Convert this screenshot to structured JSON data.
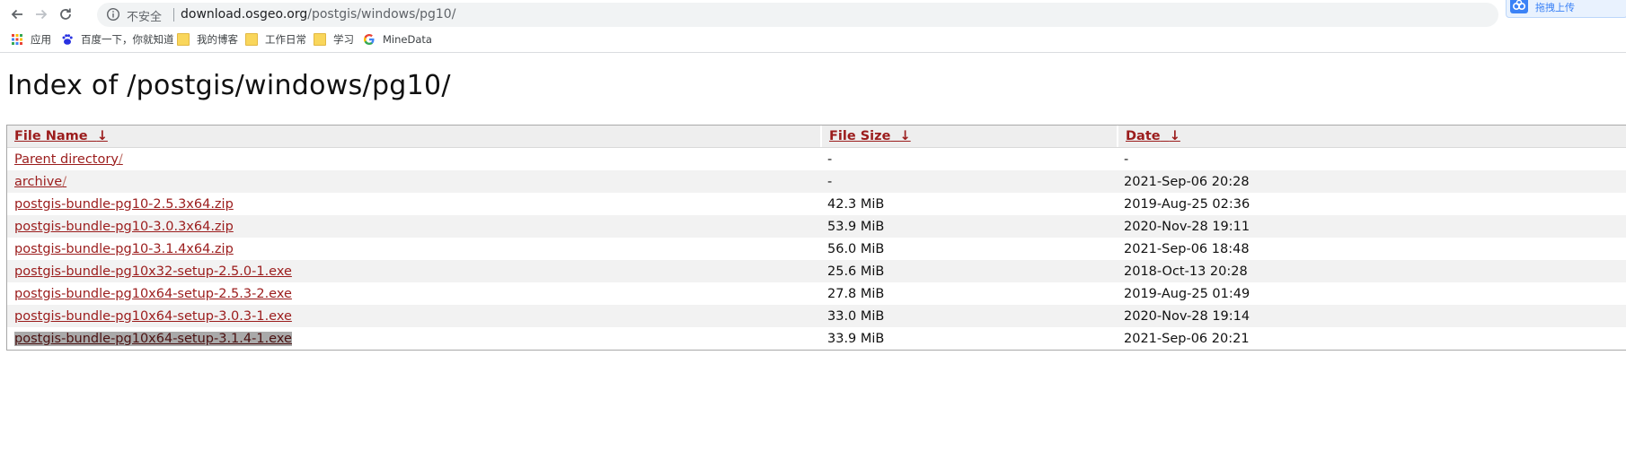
{
  "browser": {
    "omnibox": {
      "security_label": "不安全",
      "url_host": "download.osgeo.org",
      "url_path": "/postgis/windows/pg10/"
    },
    "extension_badge": {
      "label": "拖拽上传"
    }
  },
  "bookmarks": [
    {
      "label": "应用",
      "icon": "apps-grid-icon"
    },
    {
      "label": "百度一下，你就知道",
      "icon": "baidu-paw-icon"
    },
    {
      "label": "我的博客",
      "icon": "folder-icon"
    },
    {
      "label": "工作日常",
      "icon": "folder-icon"
    },
    {
      "label": "学习",
      "icon": "folder-icon"
    },
    {
      "label": "MineData",
      "icon": "google-g-icon"
    }
  ],
  "page": {
    "title": "Index of /postgis/windows/pg10/"
  },
  "table": {
    "headers": {
      "name": "File Name",
      "size": "File Size",
      "date": "Date",
      "sort_arrow": "↓"
    },
    "rows": [
      {
        "name": "Parent directory",
        "slash": "/",
        "size": "-",
        "date": "-"
      },
      {
        "name": "archive",
        "slash": "/",
        "size": "-",
        "date": "2021-Sep-06 20:28"
      },
      {
        "name": "postgis-bundle-pg10-2.5.3x64.zip",
        "slash": "",
        "size": "42.3 MiB",
        "date": "2019-Aug-25 02:36"
      },
      {
        "name": "postgis-bundle-pg10-3.0.3x64.zip",
        "slash": "",
        "size": "53.9 MiB",
        "date": "2020-Nov-28 19:11"
      },
      {
        "name": "postgis-bundle-pg10-3.1.4x64.zip",
        "slash": "",
        "size": "56.0 MiB",
        "date": "2021-Sep-06 18:48"
      },
      {
        "name": "postgis-bundle-pg10x32-setup-2.5.0-1.exe",
        "slash": "",
        "size": "25.6 MiB",
        "date": "2018-Oct-13 20:28"
      },
      {
        "name": "postgis-bundle-pg10x64-setup-2.5.3-2.exe",
        "slash": "",
        "size": "27.8 MiB",
        "date": "2019-Aug-25 01:49"
      },
      {
        "name": "postgis-bundle-pg10x64-setup-3.0.3-1.exe",
        "slash": "",
        "size": "33.0 MiB",
        "date": "2020-Nov-28 19:14"
      },
      {
        "name": "postgis-bundle-pg10x64-setup-3.1.4-1.exe",
        "slash": "",
        "size": "33.9 MiB",
        "date": "2021-Sep-06 20:21"
      }
    ]
  },
  "colors": {
    "link": "#9b1c1c",
    "row_alt": "#f2f2f2",
    "header_bg": "#eeeeee",
    "selection": "#a9a9a9"
  }
}
